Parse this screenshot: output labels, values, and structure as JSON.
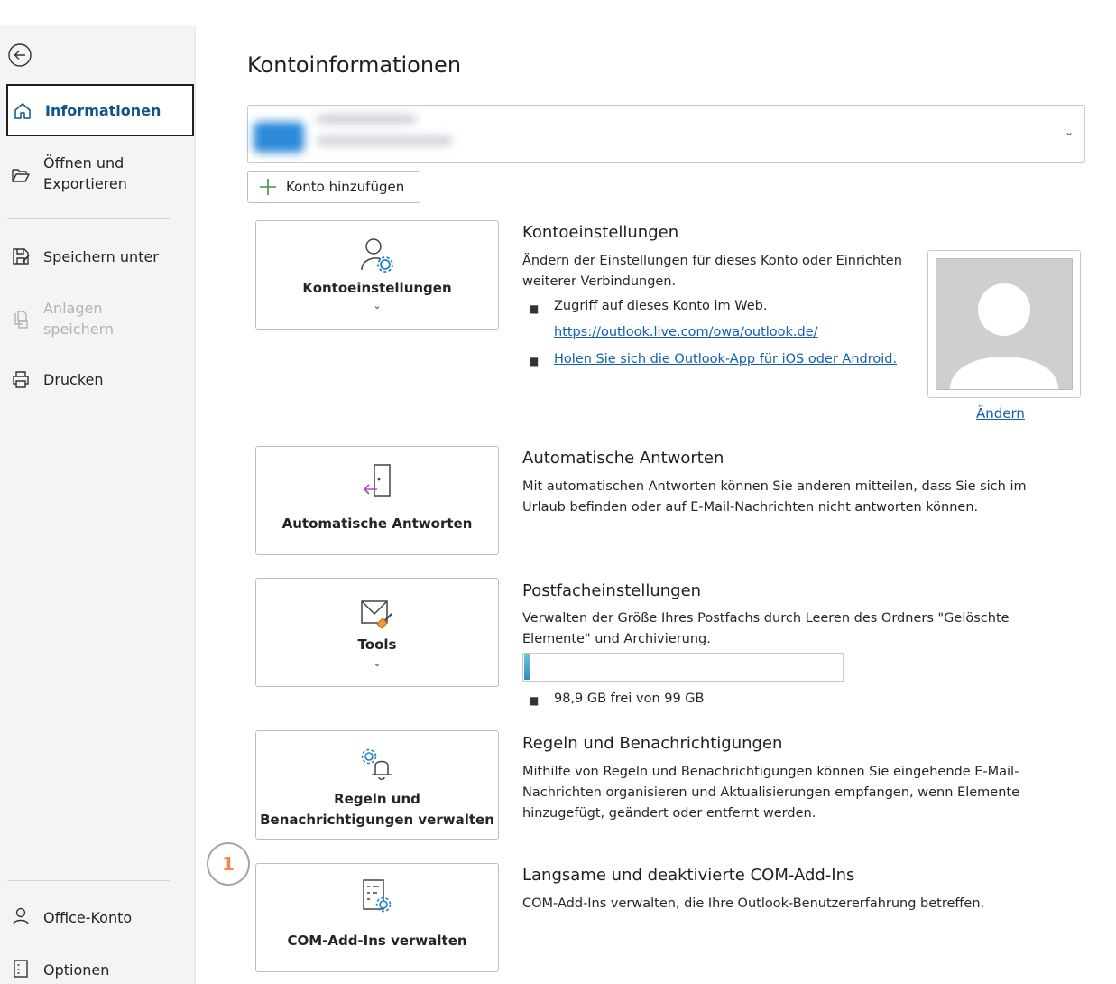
{
  "sidebar": {
    "back_icon": "back-arrow-icon",
    "items": [
      {
        "label": "Informationen",
        "icon": "home-icon"
      },
      {
        "label": "Öffnen und\nExportieren",
        "icon": "folder-open-icon"
      },
      {
        "label": "Speichern unter",
        "icon": "save-as-icon"
      },
      {
        "label": "Anlagen\nspeichern",
        "icon": "attachment-save-icon"
      },
      {
        "label": "Drucken",
        "icon": "printer-icon"
      }
    ],
    "bottom_items": [
      {
        "label": "Office-Konto",
        "icon": "person-icon"
      },
      {
        "label": "Optionen",
        "icon": "options-icon"
      }
    ]
  },
  "main": {
    "title": "Kontoinformationen",
    "account_selector": {
      "chevron": "⌄"
    },
    "add_account_label": "Konto hinzufügen",
    "sections": {
      "account_settings": {
        "tile_label": "Kontoeinstellungen",
        "tile_chevron": "⌄",
        "heading": "Kontoeinstellungen",
        "description": "Ändern der Einstellungen für dieses Konto oder Einrichten weiterer Verbindungen.",
        "bullet1": "Zugriff auf dieses Konto im Web.",
        "link1": "https://outlook.live.com/owa/outlook.de/",
        "link2": "Holen Sie sich die Outlook-App für iOS oder Android.",
        "photo_change": "Ändern"
      },
      "auto_reply": {
        "tile_label": "Automatische Antworten",
        "heading": "Automatische Antworten",
        "description": "Mit automatischen Antworten können Sie anderen mitteilen, dass Sie sich im Urlaub befinden oder auf E-Mail-Nachrichten nicht antworten können."
      },
      "mailbox": {
        "tile_label": "Tools",
        "tile_chevron": "⌄",
        "heading": "Postfacheinstellungen",
        "description": "Verwalten der Größe Ihres Postfachs durch Leeren des Ordners \"Gelöschte Elemente\" und Archivierung.",
        "usage_fraction": 0.02,
        "storage_text": "98,9 GB frei von 99 GB"
      },
      "rules": {
        "tile_label": "Regeln und\nBenachrichtigungen verwalten",
        "heading": "Regeln und Benachrichtigungen",
        "description": "Mithilfe von Regeln und Benachrichtigungen können Sie eingehende E-Mail-Nachrichten organisieren und Aktualisierungen empfangen, wenn Elemente hinzugefügt, geändert oder entfernt werden."
      },
      "com_addins": {
        "tile_label": "COM-Add-Ins verwalten",
        "heading": "Langsame und deaktivierte COM-Add-Ins",
        "description": "COM-Add-Ins verwalten, die Ihre Outlook-Benutzererfahrung betreffen."
      }
    },
    "callout_badge": "1"
  },
  "colors": {
    "accent": "#0f548c",
    "link": "#0f5fb5",
    "badge": "#f2884b",
    "sidebar_bg": "#f3f4f6"
  }
}
